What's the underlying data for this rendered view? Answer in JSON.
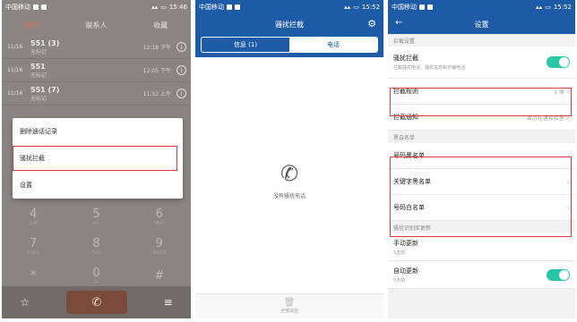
{
  "screen1": {
    "status_left": "中国移动",
    "status_time": "15:46",
    "tabs": [
      "拨号",
      "联系人",
      "收藏"
    ],
    "calls": [
      {
        "date": "11/16",
        "number": "551 (3)",
        "sub": "无标记",
        "time": "12:18 下午"
      },
      {
        "date": "11/16",
        "number": "551",
        "sub": "无标记",
        "time": "12:05 下午"
      },
      {
        "date": "11/16",
        "number": "551 (7)",
        "sub": "无标记",
        "time": "11:52 上午"
      }
    ],
    "menu": [
      "删除通话记录",
      "骚扰拦截",
      "设置"
    ],
    "dialpad": [
      [
        {
          "d": "4",
          "l": "GHI"
        },
        {
          "d": "5",
          "l": "JKL"
        },
        {
          "d": "6",
          "l": "MNO"
        }
      ],
      [
        {
          "d": "7",
          "l": "PQRS"
        },
        {
          "d": "8",
          "l": "TUV"
        },
        {
          "d": "9",
          "l": "WXYZ"
        }
      ],
      [
        {
          "d": "*",
          "l": ""
        },
        {
          "d": "0",
          "l": "+"
        },
        {
          "d": "#",
          "l": ""
        }
      ]
    ],
    "star": "☆",
    "call_icon": "✆",
    "menu_icon": "≡"
  },
  "screen2": {
    "status_left": "中国移动",
    "status_time": "15:52",
    "title": "骚扰拦截",
    "tabs": [
      "信息 (1)",
      "电话"
    ],
    "empty_text": "没有骚扰电话",
    "bottom_label": "全部清空"
  },
  "screen3": {
    "status_left": "中国移动",
    "status_time": "15:52",
    "title": "设置",
    "sec1": "拦截设置",
    "harass_label": "骚扰拦截",
    "harass_sub": "拦截骚扰电话、骚扰信息和诈骗电话",
    "rules_label": "拦截规则",
    "rules_value": "3 项",
    "notify_label": "拦截通知",
    "notify_value": "显示在通知栏里",
    "sec2": "黑白名单",
    "list_items": [
      "号码黑名单",
      "关键字黑名单",
      "号码白名单"
    ],
    "sec3": "骚扰识别库更新",
    "manual_label": "手动更新",
    "manual_sub": "5天前",
    "auto_label": "自动更新",
    "auto_sub": "5天前"
  },
  "colors": {
    "brand": "#1d5ba6",
    "toggle": "#26c6a6",
    "highlight": "#e23b3b"
  }
}
